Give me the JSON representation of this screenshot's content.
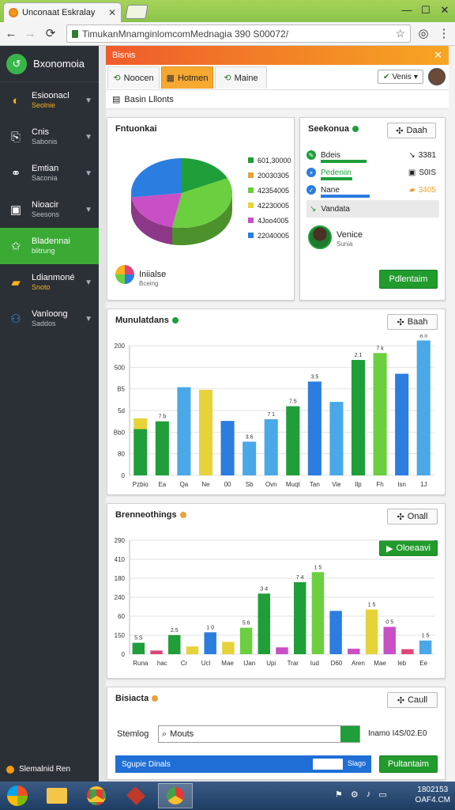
{
  "browser": {
    "tab_title": "Unconaat Eskralay",
    "url": "TimukanMnamginlomcomMednagia 390 S00072/"
  },
  "sidebar": {
    "brand": "Bxonomoia",
    "items": [
      {
        "label": "Esioonacl",
        "sub": "Seolnie",
        "icon": "globe-icon",
        "color": "#f6b21b"
      },
      {
        "label": "Cnis",
        "sub": "Sabonis",
        "icon": "document-icon",
        "color": "#ffffff"
      },
      {
        "label": "Emtian",
        "sub": "Saconia",
        "icon": "link-icon",
        "color": "#ffffff"
      },
      {
        "label": "Nioacir",
        "sub": "Seesons",
        "icon": "frame-icon",
        "color": "#ffffff"
      },
      {
        "label": "Bladennai",
        "sub": "blitrung",
        "icon": "star-icon",
        "color": "#ffffff"
      },
      {
        "label": "Ldianmoné",
        "sub": "Snoto",
        "icon": "folder-icon",
        "color": "#f6b21b"
      },
      {
        "label": "Vanloong",
        "sub": "Saddos",
        "icon": "people-icon",
        "color": "#2f9be8"
      }
    ],
    "footer": "Slemalnid Ren"
  },
  "panel": {
    "title": "Bisnis",
    "tabs": [
      "Noocen",
      "Hotmen",
      "Maine"
    ],
    "user_select": "Venis",
    "breadcrumb": "Basin Lllonts"
  },
  "pie_card": {
    "title": "Fntuonkai",
    "legend": [
      {
        "label": "601,30000",
        "color": "#1f9e3a"
      },
      {
        "label": "20030305",
        "color": "#e6a23c"
      },
      {
        "label": "42354005",
        "color": "#6ccf3f"
      },
      {
        "label": "42230005",
        "color": "#e6d33a"
      },
      {
        "label": "4Joo4005",
        "color": "#c94fc4"
      },
      {
        "label": "22040005",
        "color": "#2b7de0"
      }
    ],
    "footer_title": "Iniialse",
    "footer_sub": "Bceing"
  },
  "summary_card": {
    "title": "Seekonua",
    "button": "Daah",
    "rows": [
      {
        "label": "Bdeis",
        "value": "3381",
        "bar_color": "#1f9e3a",
        "icon_color": "#1f9e3a"
      },
      {
        "label": "Pedeniin",
        "value": "S0IS",
        "bar_color": "#1f9e3a",
        "icon_color": "#2b7de0"
      },
      {
        "label": "Nane",
        "value": "3405",
        "bar_color": "#2b7de0",
        "icon_color": "#2b7de0"
      },
      {
        "label": "Vandata",
        "value": "",
        "bar_color": "",
        "icon_color": "#1f9e3a"
      }
    ],
    "user_name": "Venice",
    "user_sub": "Sunia",
    "action": "Pdlentaim"
  },
  "chart1_card": {
    "title": "Munulatdans",
    "button": "Baah"
  },
  "chart2_card": {
    "title": "Brenneothings",
    "button": "Onall",
    "action": "Oloeaavi"
  },
  "bottom_card": {
    "title": "Bisiacta",
    "button": "Caull",
    "field_label": "Stemlog",
    "field_value": "Mouts",
    "right_text": "Inamo I4S/02.E0",
    "bar_text": "Sgupie Dinals",
    "bar_sub": "Slago",
    "action": "Pultantaim"
  },
  "taskbar": {
    "time": "1802153",
    "date": "OAF4.CM"
  },
  "chart_data": [
    {
      "type": "pie",
      "categories": [
        "601,30000",
        "20030305",
        "42354005",
        "42230005",
        "4Joo4005",
        "22040005"
      ],
      "values": [
        18,
        0,
        35,
        0,
        20,
        27
      ],
      "colors": [
        "#1f9e3a",
        "#e6a23c",
        "#6ccf3f",
        "#e6d33a",
        "#c94fc4",
        "#2b7de0"
      ]
    },
    {
      "type": "bar",
      "title": "Munulatdans",
      "categories": [
        "Pzbio",
        "Ea",
        "Qa",
        "Ne",
        "00",
        "Sb",
        "Ovn",
        "Muqt",
        "Tan",
        "Vie",
        "Ilp",
        "Fh",
        "Isn",
        "1J"
      ],
      "values": [
        107,
        125,
        204,
        198,
        126,
        78,
        130,
        160,
        217,
        170,
        267,
        283,
        235,
        312
      ],
      "stack_top": [
        25,
        0,
        0,
        0,
        0,
        0,
        0,
        0,
        0,
        0,
        0,
        0,
        0,
        0
      ],
      "colors": [
        "#1f9e3a",
        "#1f9e3a",
        "#4aa8e8",
        "#e6d33a",
        "#2b7de0",
        "#4aa8e8",
        "#4aa8e8",
        "#1f9e3a",
        "#2b7de0",
        "#4aa8e8",
        "#1f9e3a",
        "#6ccf3f",
        "#2b7de0",
        "#4aa8e8"
      ],
      "labels": [
        "",
        "7 b",
        "",
        "",
        "",
        "3.6",
        "7 1",
        "7.5",
        "3.5",
        "",
        "2.1",
        "7 k",
        "",
        "8.5"
      ],
      "yticks": [
        "0",
        "80",
        "Bb0",
        "5d",
        "B5",
        "500",
        "200"
      ],
      "ylim": [
        0,
        300
      ]
    },
    {
      "type": "bar",
      "title": "Brenneothings",
      "categories": [
        "Runa",
        "hac",
        "Cr",
        "Ucl",
        "Mae",
        "IJan",
        "Upi",
        "Trar",
        "Iud",
        "D60",
        "Aren",
        "Mae",
        "Ieb",
        "Ee"
      ],
      "series": [
        {
          "values": [
            22,
            58,
            75,
            28,
            33,
            24,
            110,
            52,
            44,
            40,
            52
          ]
        },
        {
          "values": [
            7,
            0,
            14,
            0,
            0,
            15,
            15,
            13,
            12,
            0,
            10
          ]
        }
      ],
      "colors": [
        "#1f9e3a",
        "#e0457a",
        "#1f9e3a",
        "#e6d33a",
        "#2b7de0",
        "#e6d33a",
        "#6ccf3f",
        "#1f9e3a",
        "#c94fc4",
        "#1f9e3a",
        "#6ccf3f",
        "#2b7de0",
        "#c94fc4",
        "#e6d33a",
        "#c94fc4",
        "#e0457a",
        "#4aa8e8"
      ],
      "values": [
        25,
        8,
        42,
        17,
        48,
        27,
        58,
        133,
        15,
        158,
        180,
        95,
        12,
        98,
        60,
        11,
        30
      ],
      "labels": [
        "5.S",
        "",
        "2.5",
        "",
        "1 0",
        "",
        "5.6",
        "3 4",
        "",
        "7 4",
        "1 5",
        "",
        "",
        "1 5",
        "0 5",
        "",
        "1 5"
      ],
      "yticks": [
        "0",
        "150",
        "60",
        "240",
        "180",
        "410",
        "290"
      ],
      "ylim": [
        0,
        250
      ]
    }
  ]
}
